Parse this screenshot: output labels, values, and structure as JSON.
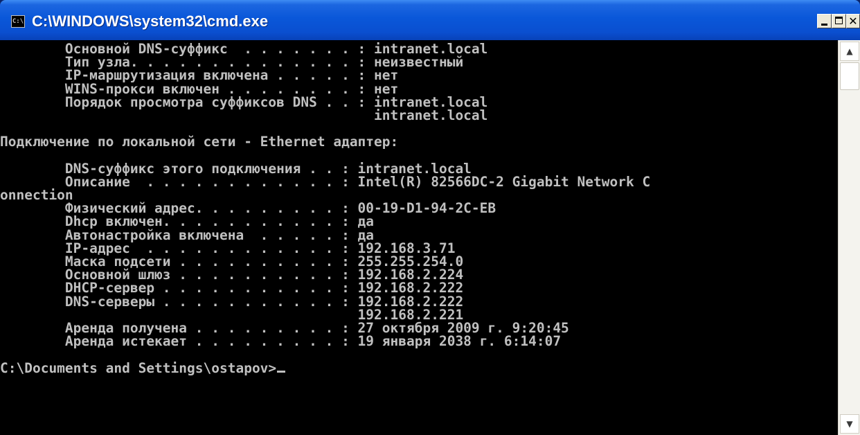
{
  "window": {
    "title": "C:\\WINDOWS\\system32\\cmd.exe",
    "icon_text": "C:\\",
    "icons": [
      "cmd-icon",
      "minimize-icon",
      "maximize-icon",
      "close-icon",
      "scroll-up-icon",
      "scroll-down-icon"
    ]
  },
  "colors": {
    "titlebar": "#0a57d9",
    "console_bg": "#000000",
    "console_text": "#c0c0c0"
  },
  "console": {
    "lines": [
      "        Основной DNS-суффикс  . . . . . . . : intranet.local",
      "        Тип узла. . . . . . . . . . . . . . : неизвестный",
      "        IP-маршрутизация включена . . . . . : нет",
      "        WINS-прокси включен . . . . . . . . : нет",
      "        Порядок просмотра суффиксов DNS . . : intranet.local",
      "                                              intranet.local",
      "",
      "Подключение по локальной сети - Ethernet адаптер:",
      "",
      "        DNS-суффикс этого подключения . . : intranet.local",
      "        Описание  . . . . . . . . . . . . : Intel(R) 82566DC-2 Gigabit Network C",
      "onnection",
      "        Физический адрес. . . . . . . . . : 00-19-D1-94-2C-EB",
      "        Dhcp включен. . . . . . . . . . . : да",
      "        Автонастройка включена  . . . . . : да",
      "        IP-адрес  . . . . . . . . . . . . : 192.168.3.71",
      "        Маска подсети . . . . . . . . . . : 255.255.254.0",
      "        Основной шлюз . . . . . . . . . . : 192.168.2.224",
      "        DHCP-сервер . . . . . . . . . . . : 192.168.2.222",
      "        DNS-серверы . . . . . . . . . . . : 192.168.2.222",
      "                                            192.168.2.221",
      "        Аренда получена . . . . . . . . . : 27 октября 2009 г. 9:20:45",
      "        Аренда истекает . . . . . . . . . : 19 января 2038 г. 6:14:07",
      "",
      "C:\\Documents and Settings\\ostapov>"
    ]
  }
}
